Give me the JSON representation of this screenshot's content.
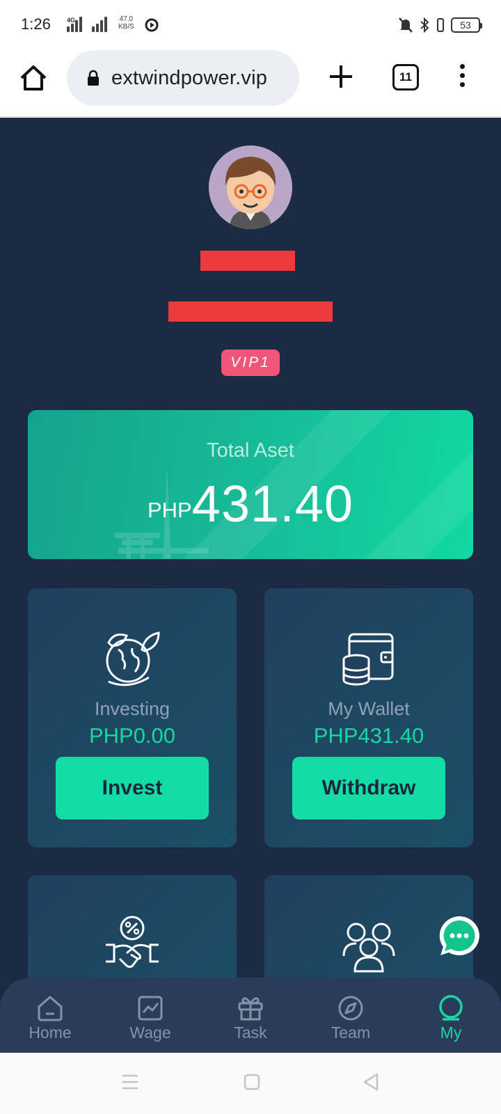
{
  "status_bar": {
    "time": "1:26",
    "network": "4G",
    "speed_value": "47.0",
    "speed_unit": "KB/S",
    "battery": "53"
  },
  "browser": {
    "url": "extwindpower.vip",
    "tab_count": "11"
  },
  "profile": {
    "vip_level": "VIP1"
  },
  "asset_card": {
    "title": "Total Aset",
    "currency": "PHP",
    "amount": "431.40"
  },
  "tiles": [
    {
      "label": "Investing",
      "value": "PHP0.00",
      "button": "Invest",
      "icon": "globe-leaves-icon"
    },
    {
      "label": "My Wallet",
      "value": "PHP431.40",
      "button": "Withdraw",
      "icon": "wallet-coins-icon"
    },
    {
      "icon": "handshake-percent-icon"
    },
    {
      "icon": "team-people-icon"
    }
  ],
  "nav": {
    "items": [
      {
        "label": "Home",
        "icon": "home-icon"
      },
      {
        "label": "Wage",
        "icon": "chart-icon"
      },
      {
        "label": "Task",
        "icon": "gift-icon"
      },
      {
        "label": "Team",
        "icon": "compass-icon"
      },
      {
        "label": "My",
        "icon": "user-icon"
      }
    ],
    "active": "My"
  },
  "colors": {
    "page_bg": "#1c2a43",
    "accent": "#17d7a3",
    "vip": "#f0567a",
    "redaction": "#ef3a3c"
  }
}
